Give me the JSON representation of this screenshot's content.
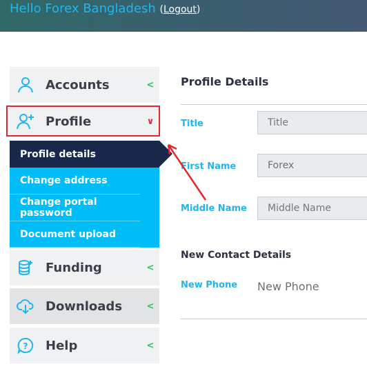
{
  "header": {
    "greeting": "Hello Forex Bangladesh",
    "logout": "Logout",
    "open_paren": "(",
    "close_paren": ")"
  },
  "sidebar": {
    "items": [
      {
        "label": "Accounts",
        "icon": "user-icon"
      },
      {
        "label": "Profile",
        "icon": "user-plus-icon",
        "expanded": true
      },
      {
        "label": "Funding",
        "icon": "coins-icon"
      },
      {
        "label": "Downloads",
        "icon": "cloud-download-icon"
      },
      {
        "label": "Help",
        "icon": "help-icon"
      }
    ],
    "submenu": [
      "Profile details",
      "Change address",
      "Change portal password",
      "Document upload"
    ],
    "colors": {
      "active_sub": "#17284a",
      "submenu_bg": "#00bdf8",
      "highlight": "#e3262b"
    }
  },
  "main": {
    "title": "Profile Details",
    "fields": [
      {
        "label": "Title",
        "placeholder": "Title",
        "value": ""
      },
      {
        "label": "First Name",
        "placeholder": "First Name",
        "value": "Forex"
      },
      {
        "label": "Middle Name",
        "placeholder": "Middle Name",
        "value": ""
      }
    ],
    "contact_title": "New Contact Details",
    "phone_label": "New Phone",
    "phone_value": "New Phone"
  }
}
